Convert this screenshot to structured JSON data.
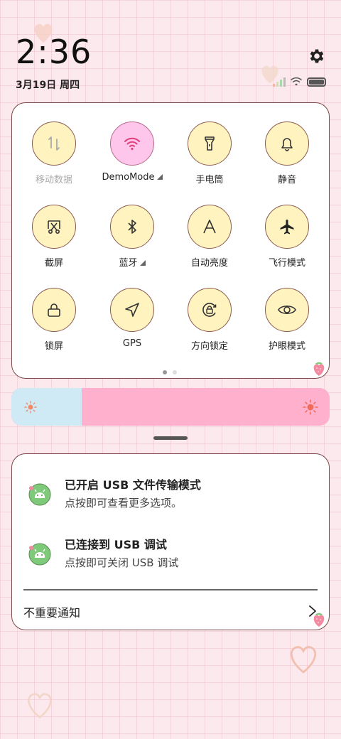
{
  "status": {
    "time": "2:36",
    "date": "3月19日 周四"
  },
  "tiles": [
    {
      "label": "移动数据",
      "icon": "mobile-data-icon",
      "active": false,
      "disabled": true,
      "expand": false
    },
    {
      "label": "DemoMode",
      "icon": "wifi-icon",
      "active": true,
      "disabled": false,
      "expand": true
    },
    {
      "label": "手电筒",
      "icon": "flashlight-icon",
      "active": false,
      "disabled": false,
      "expand": false
    },
    {
      "label": "静音",
      "icon": "bell-icon",
      "active": false,
      "disabled": false,
      "expand": false
    },
    {
      "label": "截屏",
      "icon": "screenshot-icon",
      "active": false,
      "disabled": false,
      "expand": false
    },
    {
      "label": "蓝牙",
      "icon": "bluetooth-icon",
      "active": false,
      "disabled": false,
      "expand": true
    },
    {
      "label": "自动亮度",
      "icon": "auto-brightness-icon",
      "active": false,
      "disabled": false,
      "expand": false
    },
    {
      "label": "飞行模式",
      "icon": "airplane-icon",
      "active": false,
      "disabled": false,
      "expand": false
    },
    {
      "label": "锁屏",
      "icon": "lock-icon",
      "active": false,
      "disabled": false,
      "expand": false
    },
    {
      "label": "GPS",
      "icon": "location-arrow-icon",
      "active": false,
      "disabled": false,
      "expand": false
    },
    {
      "label": "方向锁定",
      "icon": "rotation-lock-icon",
      "active": false,
      "disabled": false,
      "expand": false
    },
    {
      "label": "护眼模式",
      "icon": "eye-icon",
      "active": false,
      "disabled": false,
      "expand": false
    }
  ],
  "page_indicator": {
    "count": 2,
    "current": 1
  },
  "brightness": {
    "level": 0.22
  },
  "notifications": [
    {
      "title": "已开启 USB 文件传输模式",
      "text": "点按即可查看更多选项。",
      "icon": "android-usb-icon"
    },
    {
      "title": "已连接到 USB 调试",
      "text": "点按即可关闭 USB 调试",
      "icon": "android-usb-icon"
    }
  ],
  "unimportant_label": "不重要通知",
  "colors": {
    "background": "#fbe9ee",
    "tile_fill": "#fff3bf",
    "tile_active_fill": "#ffc6ec",
    "brightness_track": "#ffb0cc",
    "brightness_fill": "#cfe9f5",
    "notif_icon": "#7fc97a"
  }
}
